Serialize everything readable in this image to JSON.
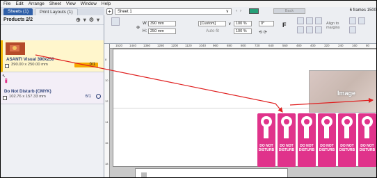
{
  "menu": [
    "File",
    "Edit",
    "Arrange",
    "Sheet",
    "View",
    "Window",
    "Help"
  ],
  "tabs": {
    "sheets": "Sheets (1)",
    "print_layouts": "Print Layouts (1)"
  },
  "products_header": {
    "title": "Products 2/2"
  },
  "products": [
    {
      "name": "ASANTI Visual 390x250",
      "size": "390.00 x 250.00 mm",
      "count": "0/1",
      "selected": true
    },
    {
      "name": "Do Not Disturb (CMYK)",
      "size": "102.76 x 157.33 mm",
      "count": "6/1",
      "selected": false
    }
  ],
  "toolbar": {
    "sheet_name": "Sheet 1",
    "back_label": "Back",
    "frames_label": "6 frames  1500",
    "w_label": "W:",
    "w_value": "390 mm",
    "h_label": "H:",
    "h_value": "250 mm",
    "preset_value": "[Custom]",
    "autofit_label": "Auto-fit",
    "scale1": "100 %",
    "scale2": "100 %",
    "rotation": "0°",
    "align_label": "Align to margins"
  },
  "ruler_labels": [
    "1520",
    "1440",
    "1360",
    "1280",
    "1200",
    "1120",
    "1040",
    "960",
    "880",
    "800",
    "720",
    "640",
    "560",
    "480",
    "400",
    "320",
    "240",
    "160",
    "80"
  ],
  "canvas": {
    "image_label": "Image",
    "dnd_text": [
      "DO NOT DISTURB",
      "DO NOT DISTURB",
      "DO NOT DISTURB",
      "DO NOT DISTURB",
      "DO NOT DISTURB",
      "DO NOT DISTURB"
    ]
  },
  "colors": {
    "accent": "#2f5fa8",
    "orange_badge": "#f5a800",
    "dnd_pink": "#e0338b",
    "arrow_red": "#e02020"
  }
}
